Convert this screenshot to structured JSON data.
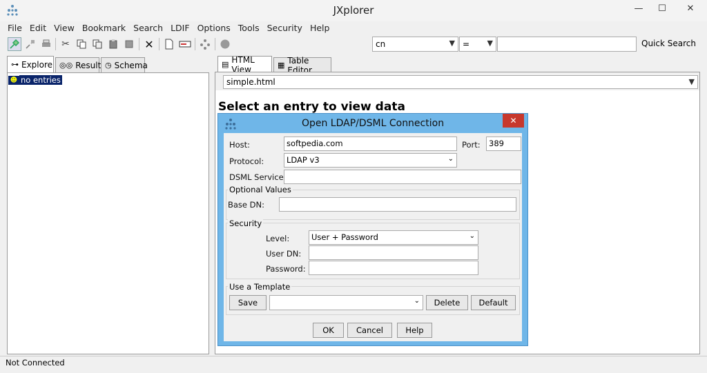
{
  "window": {
    "title": "JXplorer",
    "minimize": "—",
    "maximize": "☐",
    "close": "✕"
  },
  "menu": [
    "File",
    "Edit",
    "View",
    "Bookmark",
    "Search",
    "LDIF",
    "Options",
    "Tools",
    "Security",
    "Help"
  ],
  "quick_search": {
    "attribute": "cn",
    "operator": "=",
    "value": "",
    "button": "Quick Search"
  },
  "left_tabs": {
    "explore": "Explore",
    "results": "Results",
    "schema": "Schema"
  },
  "tree": {
    "root_label": "no entries"
  },
  "right_tabs": {
    "html_view": "HTML View",
    "table_editor": "Table Editor"
  },
  "template_select": "simple.html",
  "html_heading": "Select an entry to view data",
  "dialog": {
    "title": "Open LDAP/DSML Connection",
    "host_label": "Host:",
    "host_value": "softpedia.com",
    "port_label": "Port:",
    "port_value": "389",
    "protocol_label": "Protocol:",
    "protocol_value": "LDAP v3",
    "dsml_label": "DSML Service:",
    "dsml_value": "",
    "optional_title": "Optional Values",
    "base_dn_label": "Base DN:",
    "base_dn_value": "",
    "security_title": "Security",
    "level_label": "Level:",
    "level_value": "User + Password",
    "user_dn_label": "User DN:",
    "user_dn_value": "",
    "password_label": "Password:",
    "password_value": "",
    "template_title": "Use a Template",
    "save_button": "Save",
    "template_value": "",
    "delete_button": "Delete",
    "default_button": "Default",
    "ok_button": "OK",
    "cancel_button": "Cancel",
    "help_button": "Help"
  },
  "status": "Not Connected",
  "colors": {
    "dialog_frame": "#6fb6e8",
    "close_red": "#c7382d",
    "selection": "#0a246a"
  }
}
